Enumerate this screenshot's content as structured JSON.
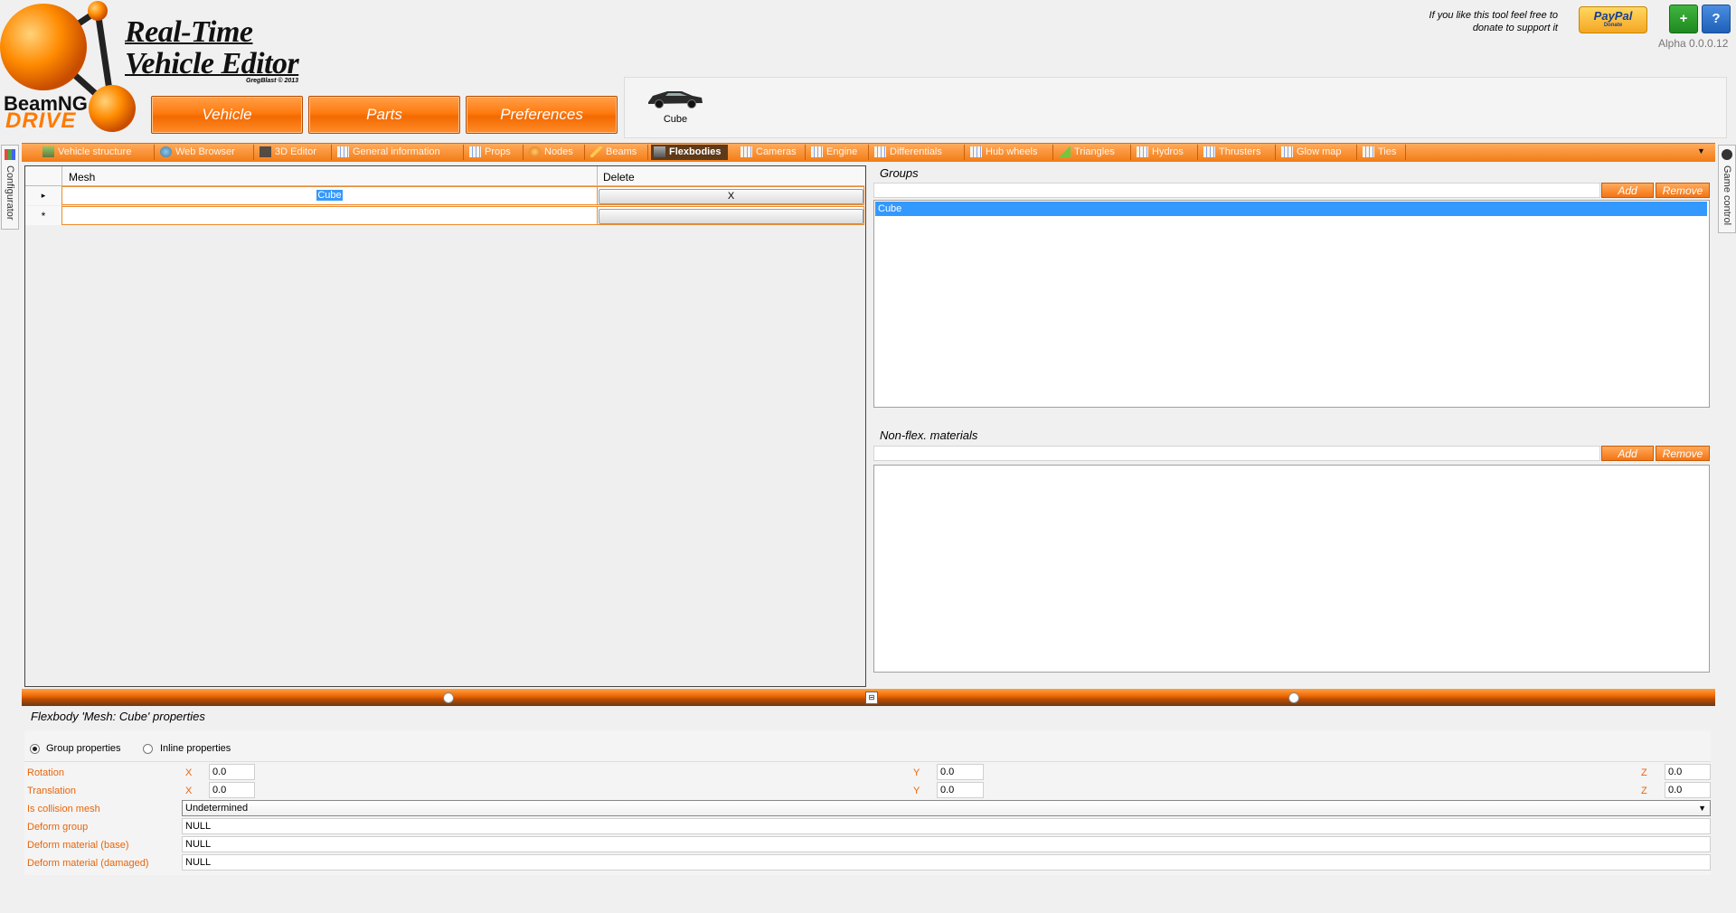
{
  "header": {
    "logo_text_1": "BeamNG",
    "logo_text_2": "DRIVE",
    "title_line1": "Real-Time",
    "title_line2": "Vehicle Editor",
    "credit": "GregBlast © 2013",
    "main_buttons": [
      "Vehicle",
      "Parts",
      "Preferences"
    ],
    "vehicle_name": "Cube",
    "support_text_1": "If you like this tool feel free to",
    "support_text_2": "donate to support it",
    "paypal_label": "PayPal",
    "paypal_sub": "Donate",
    "plus_label": "+",
    "help_label": "?",
    "version": "Alpha 0.0.0.12"
  },
  "side_tabs": {
    "left": "Configurator",
    "right": "Game control"
  },
  "tabs": [
    {
      "label": "Vehicle structure",
      "icon": "vehicle-structure-icon"
    },
    {
      "label": "Web Browser",
      "icon": "globe-icon"
    },
    {
      "label": "3D Editor",
      "icon": "3d-editor-icon"
    },
    {
      "label": "General information",
      "icon": "grid-icon"
    },
    {
      "label": "Props",
      "icon": "grid-icon"
    },
    {
      "label": "Nodes",
      "icon": "node-icon"
    },
    {
      "label": "Beams",
      "icon": "pencil-icon"
    },
    {
      "label": "Flexbodies",
      "icon": "flexbody-icon",
      "active": true
    },
    {
      "label": "Cameras",
      "icon": "grid-icon"
    },
    {
      "label": "Engine",
      "icon": "grid-icon"
    },
    {
      "label": "Differentials",
      "icon": "grid-icon"
    },
    {
      "label": "Hub wheels",
      "icon": "grid-icon"
    },
    {
      "label": "Triangles",
      "icon": "triangle-icon"
    },
    {
      "label": "Hydros",
      "icon": "grid-icon"
    },
    {
      "label": "Thrusters",
      "icon": "grid-icon"
    },
    {
      "label": "Glow map",
      "icon": "grid-icon"
    },
    {
      "label": "Ties",
      "icon": "grid-icon"
    }
  ],
  "mesh_grid": {
    "columns": [
      "Mesh",
      "Delete"
    ],
    "rows": [
      {
        "mesh": "Cube",
        "delete": "X"
      }
    ],
    "current_row_marker": "▸",
    "new_row_marker": "*"
  },
  "groups": {
    "title": "Groups",
    "add_label": "Add",
    "remove_label": "Remove",
    "items": [
      "Cube"
    ]
  },
  "nonflex": {
    "title": "Non-flex. materials",
    "add_label": "Add",
    "remove_label": "Remove"
  },
  "properties": {
    "title": "Flexbody 'Mesh: Cube' properties",
    "radio_group": "Group properties",
    "radio_inline": "Inline properties",
    "rotation_label": "Rotation",
    "translation_label": "Translation",
    "x_axis": "X",
    "y_axis": "Y",
    "z_axis": "Z",
    "rotation": {
      "x": "0.0",
      "y": "0.0",
      "z": "0.0"
    },
    "translation": {
      "x": "0.0",
      "y": "0.0",
      "z": "0.0"
    },
    "collision_label": "Is collision mesh",
    "collision_value": "Undetermined",
    "deform_group_label": "Deform group",
    "deform_group_value": "NULL",
    "deform_base_label": "Deform material (base)",
    "deform_base_value": "NULL",
    "deform_damaged_label": "Deform material (damaged)",
    "deform_damaged_value": "NULL"
  },
  "colors": {
    "accent": "#f47414",
    "label_orange": "#e8650a",
    "selection": "#3399ff"
  }
}
